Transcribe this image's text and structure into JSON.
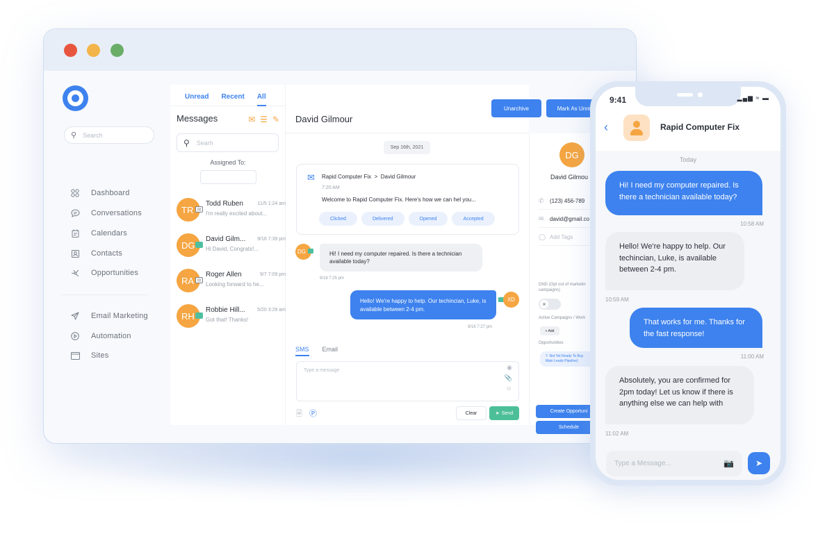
{
  "window": {
    "traffic_lights": [
      "close",
      "minimize",
      "maximize"
    ],
    "logo_icon": "target-ring-icon"
  },
  "sidebar": {
    "search_placeholder": "Search",
    "items": [
      {
        "label": "Dashboard",
        "icon": "grid-icon"
      },
      {
        "label": "Conversations",
        "icon": "chat-bubble-icon"
      },
      {
        "label": "Calendars",
        "icon": "calendar-icon"
      },
      {
        "label": "Contacts",
        "icon": "contact-card-icon"
      },
      {
        "label": "Opportunities",
        "icon": "network-icon"
      },
      {
        "label": "Email Marketing",
        "icon": "paper-plane-icon"
      },
      {
        "label": "Automation",
        "icon": "play-circle-icon"
      },
      {
        "label": "Sites",
        "icon": "browser-window-icon"
      }
    ]
  },
  "messages": {
    "tabs": [
      {
        "label": "Unread",
        "active": false
      },
      {
        "label": "Recent",
        "active": false
      },
      {
        "label": "All",
        "active": true
      }
    ],
    "title": "Messages",
    "search_placeholder": "Searh",
    "assigned_label": "Assigned To:",
    "assigned_value": "",
    "conversations": [
      {
        "initials": "TR",
        "name": "Todd Ruben",
        "time": "11/5 1:24 am",
        "preview": "I'm really excited about...",
        "channel": "email"
      },
      {
        "initials": "DG",
        "name": "David Gilm...",
        "time": "9/16 7:39 pm",
        "preview": "Hi David, Congrats!...",
        "channel": "sms"
      },
      {
        "initials": "RA",
        "name": "Roger Allen",
        "time": "9/7 7:09 pm",
        "preview": "Looking forward to he...",
        "channel": "email"
      },
      {
        "initials": "RH",
        "name": "Robbie Hill...",
        "time": "5/20 3:29 am",
        "preview": "Got that! Thanks!",
        "channel": "sms"
      }
    ]
  },
  "chat": {
    "contact_name": "David Gilmour",
    "actions": {
      "unarchive": "Unarchive",
      "mark_unread": "Mark As Unre"
    },
    "date": "Sep 16th, 2021",
    "email": {
      "from": "Rapid Computer Fix",
      "separator": ">",
      "to": "David Gilmour",
      "time": "7:20 AM",
      "body": "Welcome to Rapid Computer Fix. Here's how we can hel you...",
      "statuses": [
        "Clicked",
        "Delivered",
        "Opened",
        "Accepted"
      ]
    },
    "incoming": {
      "initials": "DG",
      "text": "Hi! I need my computer repaired. Is there a technician available today?",
      "time": "9/16 7:25 pm"
    },
    "outgoing": {
      "initials": "XD",
      "text": "Hello! We're happy to help. Our techincian, Luke, is available between 2-4 pm.",
      "time": "9/16 7:27 pm"
    },
    "compose_tabs": [
      {
        "label": "SMS",
        "active": true
      },
      {
        "label": "Email",
        "active": false
      }
    ],
    "compose_placeholder": "Type a message",
    "clear_label": "Clear",
    "send_label": "Send"
  },
  "profile": {
    "initials": "DG",
    "name": "David Gilmou",
    "phone": "(123) 456-789",
    "email": "david@gmail.co",
    "tags_placeholder": "Add Tags",
    "dnd_label_1": "DND (Opt out of marketin",
    "dnd_label_2": "campaigns)",
    "dnd_enabled": false,
    "campaigns_label": "Active Campaigns / Work",
    "add_label": "+ Add",
    "opportunities_label": "Opportunities",
    "opportunity_1": "7. Not Yet Ready To Buy",
    "opportunity_2": "Main Leads Pipeline)",
    "create_opportunity": "Create Opportuni",
    "schedule": "Schedule"
  },
  "phone": {
    "time": "9:41",
    "status_icons": "signal wifi battery",
    "contact": "Rapid Computer Fix",
    "day_label": "Today",
    "messages": [
      {
        "direction": "out",
        "text": "Hi! I need my computer repaired. Is there a technician available today?",
        "time": "10:58 AM"
      },
      {
        "direction": "in",
        "text": "Hello! We're happy to help. Our techincian, Luke, is available between 2-4 pm.",
        "time": "10:59 AM"
      },
      {
        "direction": "out",
        "text": "That works for me. Thanks for the fast response!",
        "time": "11:00 AM"
      },
      {
        "direction": "in",
        "text": "Absolutely, you are confirmed for 2pm today! Let us know if there is anything else we can help with",
        "time": "11:02 AM"
      }
    ],
    "input_placeholder": "Type a Message..."
  },
  "colors": {
    "accent_blue": "#3d82ee",
    "avatar_orange": "#f5a541",
    "send_green": "#4dbf98"
  }
}
